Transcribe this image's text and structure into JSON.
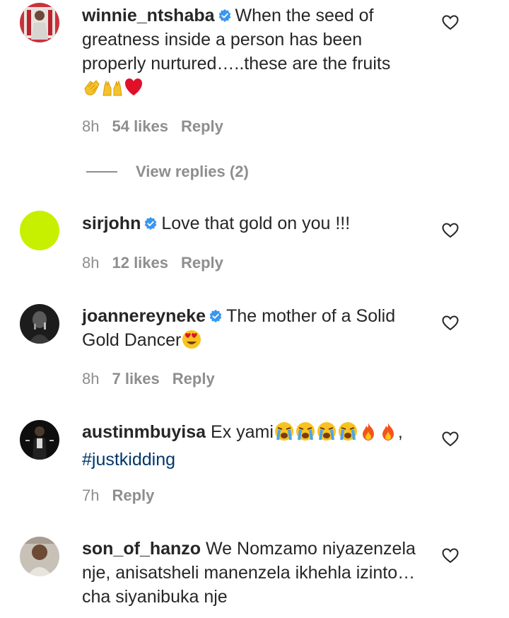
{
  "comments": [
    {
      "username": "winnie_ntshaba",
      "verified": true,
      "text": "When the seed of greatness inside a person has been properly nurtured…..these are the fruits",
      "time": "8h",
      "likes": "54 likes",
      "reply": "Reply",
      "view_replies": "View replies (2)"
    },
    {
      "username": "sirjohn",
      "verified": true,
      "text": "Love that gold on you !!!",
      "time": "8h",
      "likes": "12 likes",
      "reply": "Reply"
    },
    {
      "username": "joannereyneke",
      "verified": true,
      "text": "The mother of a Solid Gold Dancer",
      "time": "8h",
      "likes": "7 likes",
      "reply": "Reply"
    },
    {
      "username": "austinmbuyisa",
      "verified": false,
      "text": "Ex yami",
      "text_suffix": ",",
      "hashtag": "#justkidding",
      "time": "7h",
      "reply": "Reply"
    },
    {
      "username": "son_of_hanzo",
      "verified": false,
      "text": "We Nomzamo niyazenzela nje, anisatsheli manenzela ikhehla izinto… cha siyanibuka nje"
    }
  ],
  "icons": {
    "heart": "heart-outline-icon",
    "verified": "verified-badge-icon"
  },
  "colors": {
    "text": "#262626",
    "meta": "#8e8e8e",
    "verified": "#3897f0",
    "hashtag": "#00376b",
    "sirjohn_avatar": "#c6f000"
  }
}
